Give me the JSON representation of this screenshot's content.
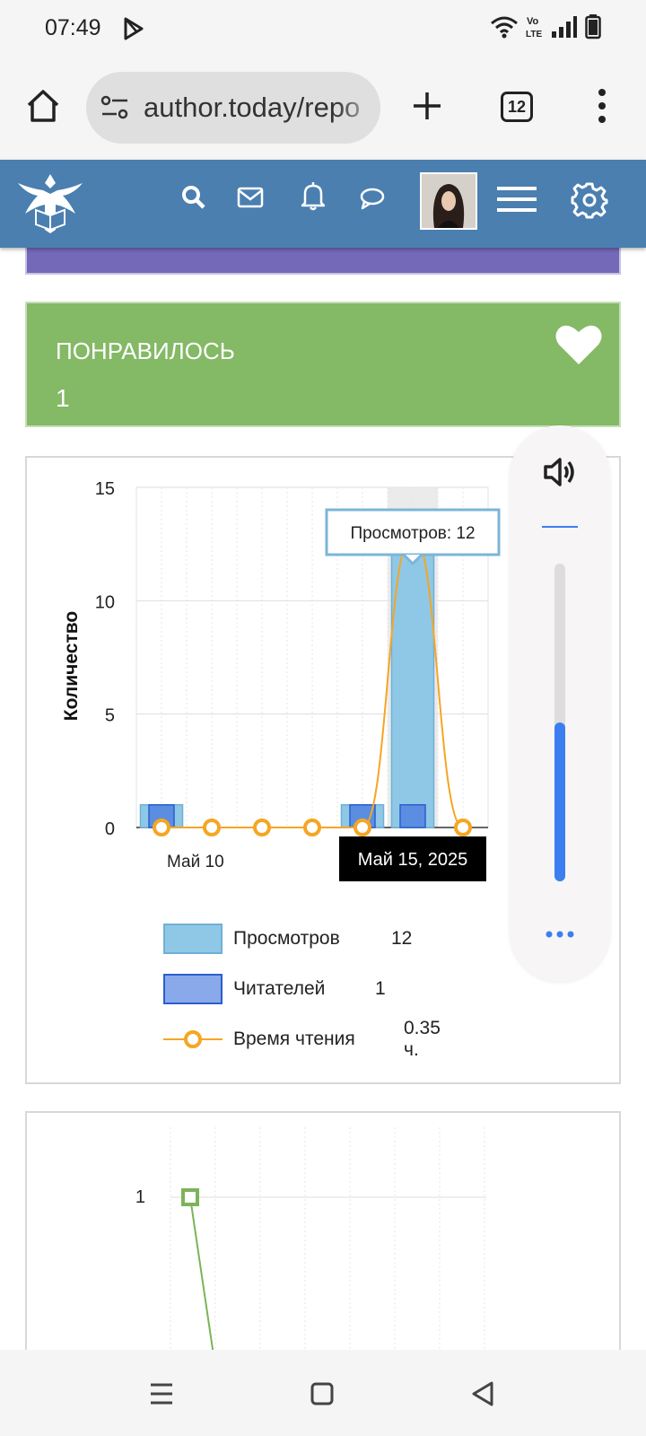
{
  "status_bar": {
    "time": "07:49",
    "icons": [
      "play-store-icon",
      "wifi-icon",
      "volte-icon",
      "signal-icon",
      "battery-icon"
    ],
    "volte_label": "Vo LTE"
  },
  "browser": {
    "url": "author.today/repo",
    "tab_count": "12",
    "icons": [
      "home-icon",
      "site-settings-icon",
      "new-tab-icon",
      "menu-dots-icon"
    ]
  },
  "site_header": {
    "background": "#4a7fb0",
    "icons": [
      "eagle-logo",
      "search-icon",
      "mail-icon",
      "bell-icon",
      "chat-icon",
      "avatar",
      "hamburger-icon",
      "gear-icon"
    ]
  },
  "liked_card": {
    "title": "ПОНРАВИЛОСЬ",
    "count": "1",
    "color": "#84b966",
    "icon": "heart-icon"
  },
  "chart_data": [
    {
      "type": "bar",
      "ylabel": "Количество",
      "ylim": [
        0,
        15
      ],
      "yticks": [
        "0",
        "5",
        "10",
        "15"
      ],
      "x_first_label": "Май 10",
      "hover_x_label": "Май 15, 2025",
      "tooltip": "Просмотров: 12",
      "categories_count": 7,
      "series": [
        {
          "name": "Просмотров",
          "kind": "bar",
          "color": "#8fc8e6",
          "values": [
            1,
            0,
            0,
            0,
            1,
            12,
            0
          ]
        },
        {
          "name": "Читателей",
          "kind": "bar",
          "color": "#5b8ee0",
          "values": [
            1,
            0,
            0,
            0,
            1,
            1,
            0
          ]
        },
        {
          "name": "Время чтения",
          "kind": "line",
          "color": "#f5a623",
          "values": [
            0,
            0,
            0,
            0,
            0,
            13,
            0
          ]
        }
      ],
      "legend": [
        {
          "label": "Просмотров",
          "value": "12"
        },
        {
          "label": "Читателей",
          "value": "1"
        },
        {
          "label": "Время чтения",
          "value": "0.35 ч."
        }
      ]
    },
    {
      "type": "line",
      "yticks": [
        "1"
      ],
      "series": [
        {
          "kind": "line",
          "color": "#7cb35a",
          "values": [
            1,
            0
          ]
        }
      ]
    }
  ],
  "volume_panel": {
    "icon": "speaker-icon",
    "level_percent": 50,
    "more_icon": "more-dots-icon"
  },
  "nav_bar": {
    "icons": [
      "recents-icon",
      "home-nav-icon",
      "back-icon"
    ]
  }
}
